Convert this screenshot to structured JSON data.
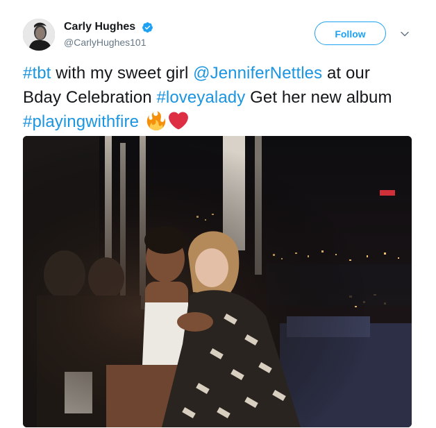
{
  "author": {
    "display_name": "Carly Hughes",
    "username": "@CarlyHughes101",
    "verified": true,
    "avatar_icon": "profile-avatar"
  },
  "follow_button": {
    "label": "Follow"
  },
  "menu": {
    "icon": "chevron-down-icon"
  },
  "tweet": {
    "segments": [
      {
        "type": "hashtag",
        "text": "#tbt"
      },
      {
        "type": "text",
        "text": " with my sweet girl "
      },
      {
        "type": "mention",
        "text": "@JenniferNettles"
      },
      {
        "type": "text",
        "text": " at our Bday Celebration "
      },
      {
        "type": "hashtag",
        "text": "#loveyalady"
      },
      {
        "type": "text",
        "text": " Get her new album "
      },
      {
        "type": "hashtag",
        "text": "#playingwithfire"
      }
    ],
    "emojis": [
      "fire-emoji",
      "red-heart-emoji"
    ]
  },
  "media": {
    "kind": "photo",
    "icon": "photo-two-women-at-night-rooftop"
  },
  "colors": {
    "link": "#1b95e0",
    "follow": "#1da1f2",
    "text": "#14171a",
    "muted": "#657786",
    "verified": "#1da1f2",
    "heart": "#dd2e44"
  }
}
